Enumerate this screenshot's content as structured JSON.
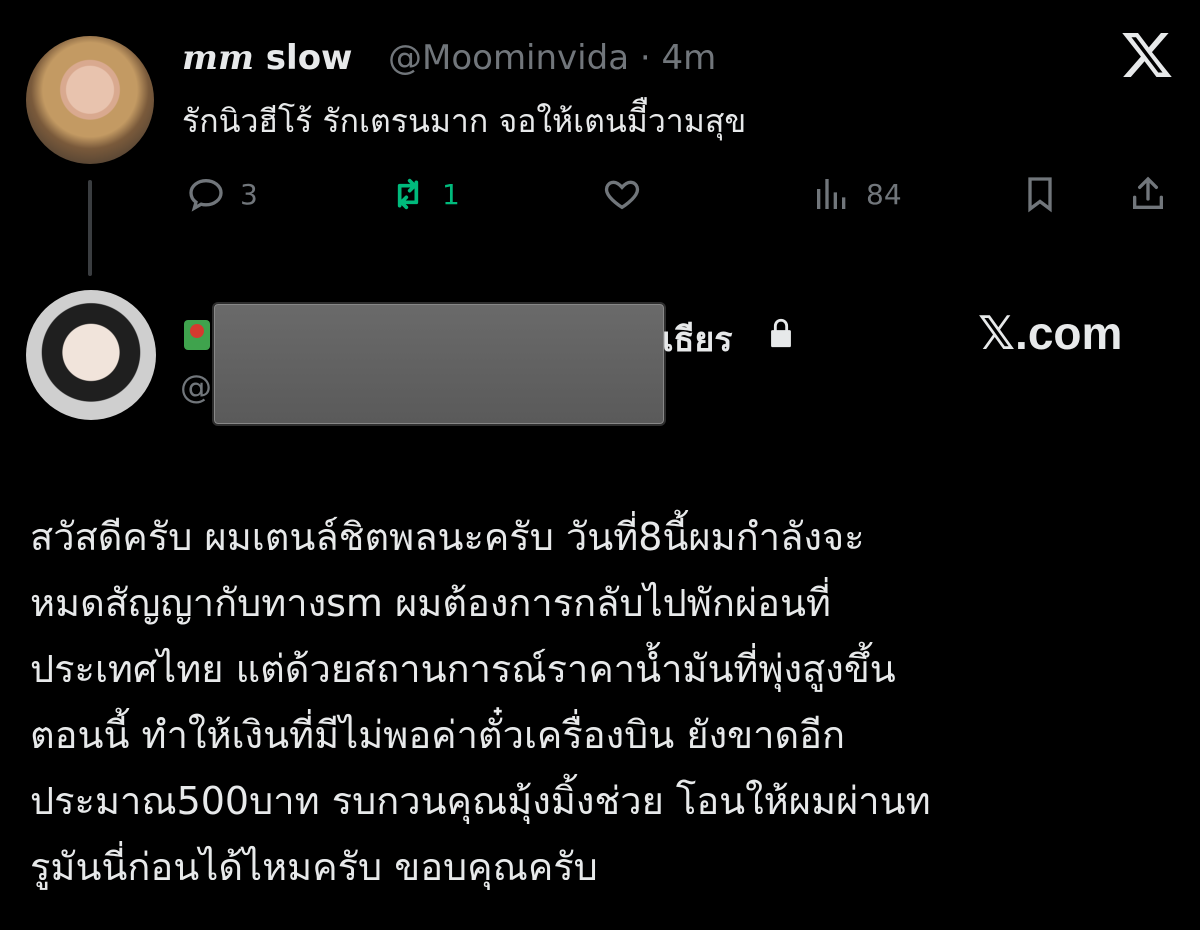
{
  "tweet": {
    "display_name_italic": "mm",
    "display_name_rest": "slow",
    "handle_meta": "@Moominvida · 4m",
    "text": "รักนิวฮีโร้ รักเตรนมาก จอให้เตนมีืวามสุข",
    "replies": "3",
    "retweets": "1",
    "views": "84",
    "colors": {
      "retweet": "#00ba7c",
      "muted": "#71767b"
    },
    "icons": [
      "reply-icon",
      "retweet-icon",
      "like-icon",
      "views-icon",
      "bookmark-icon",
      "share-icon"
    ]
  },
  "quoted_account": {
    "name_tail": "เธียร",
    "handle_start": "@"
  },
  "watermark": "𝕏.com",
  "body_lines": [
    "สวัสดีครับ ผมเตนล์ชิตพลนะครับ วันที่8นี้ผมกำลังจะ",
    "หมดสัญญากับทางsm ผมต้องการกลับไปพักผ่อนที่",
    "ประเทศไทย แต่ด้วยสถานการณ์ราคาน้ำมันที่พุ่งสูงขึ้น",
    "ตอนนี้ ทำให้เงินที่มีไม่พอค่าตั๋วเครื่องบิน ยังขาดอีก",
    "ประมาณ500บาท รบกวนคุณมุ้งมิ้งช่วย โอนให้ผมผ่านท",
    "รูมันนี่ก่อนได้ไหมครับ ขอบคุณครับ"
  ]
}
